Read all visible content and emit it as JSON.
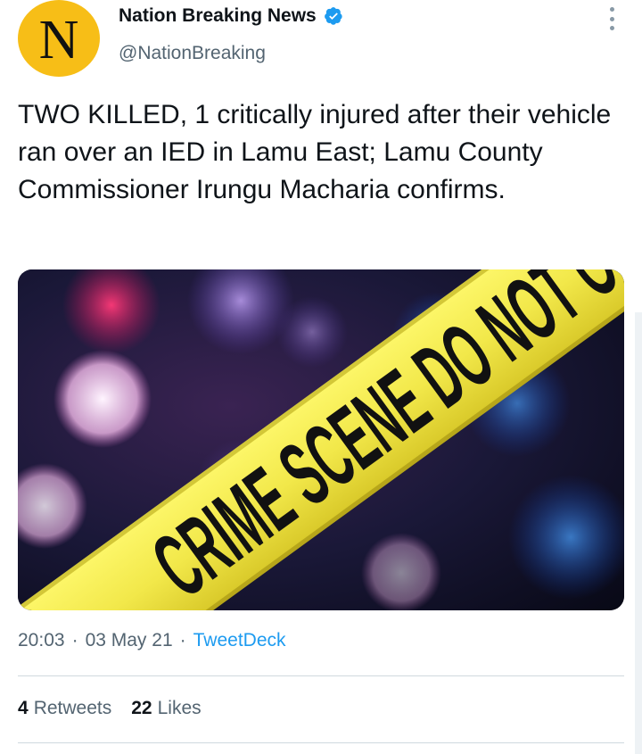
{
  "header": {
    "avatar_letter": "N",
    "display_name": "Nation Breaking News",
    "handle": "@NationBreaking",
    "verified_icon": "verified-badge-icon",
    "menu_icon": "more-vertical-icon"
  },
  "tweet": {
    "text": "TWO KILLED, 1 critically injured after their vehicle ran over an IED in Lamu East; Lamu County Commissioner Irungu Macharia confirms.",
    "media_tape_text": "CRIME SCENE DO NOT CROSS",
    "time": "20:03",
    "date": "03 May 21",
    "separator": "·",
    "source": "TweetDeck"
  },
  "stats": {
    "retweets_count": "4",
    "retweets_label": "Retweets",
    "likes_count": "22",
    "likes_label": "Likes"
  },
  "colors": {
    "accent": "#1d9bf0",
    "avatar_bg": "#f7be17",
    "tape": "#f2e84a",
    "secondary_text": "#536471"
  }
}
